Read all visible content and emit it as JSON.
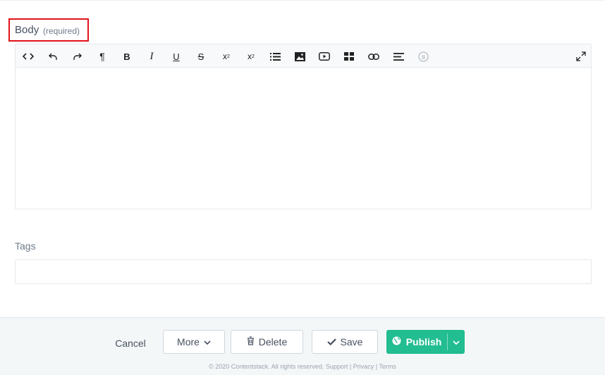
{
  "body_field": {
    "label": "Body",
    "hint": "(required)"
  },
  "toolbar": {
    "items": [
      {
        "name": "source-code-icon",
        "glyph": "<>"
      },
      {
        "name": "undo-icon",
        "glyph": "↶"
      },
      {
        "name": "redo-icon",
        "glyph": "↷"
      },
      {
        "name": "paragraph-icon",
        "glyph": "¶"
      },
      {
        "name": "bold-icon",
        "glyph": "B"
      },
      {
        "name": "italic-icon",
        "glyph": "I"
      },
      {
        "name": "underline-icon",
        "glyph": "U"
      },
      {
        "name": "strikethrough-icon",
        "glyph": "S"
      },
      {
        "name": "superscript-icon",
        "glyph": "x²"
      },
      {
        "name": "subscript-icon",
        "glyph": "x₂"
      },
      {
        "name": "bullet-list-icon",
        "glyph": ""
      },
      {
        "name": "image-icon",
        "glyph": ""
      },
      {
        "name": "video-icon",
        "glyph": ""
      },
      {
        "name": "table-icon",
        "glyph": ""
      },
      {
        "name": "link-icon",
        "glyph": ""
      },
      {
        "name": "align-left-icon",
        "glyph": ""
      },
      {
        "name": "emoji-icon",
        "glyph": ""
      }
    ],
    "expand_icon": "expand-icon"
  },
  "tags_field": {
    "label": "Tags",
    "value": ""
  },
  "footer": {
    "cancel_label": "Cancel",
    "more_label": "More",
    "delete_label": "Delete",
    "save_label": "Save",
    "publish_label": "Publish",
    "copyright": "© 2020 Contentstack. All rights reserved. Support | Privacy | Terms"
  },
  "colors": {
    "publish_green": "#22bd91",
    "highlight_red": "#e0131a"
  }
}
